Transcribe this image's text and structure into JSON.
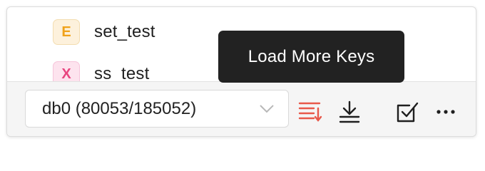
{
  "keys": [
    {
      "type_letter": "E",
      "name": "set_test",
      "color": "#f0a21b"
    },
    {
      "type_letter": "X",
      "name": "ss_test",
      "color": "#e8457f"
    }
  ],
  "toolbar": {
    "db_select_value": "db0 (80053/185052)",
    "icons": [
      "sort-keys-icon",
      "load-keys-icon",
      "batch-select-icon",
      "more-icon"
    ],
    "sort_icon_color": "#e8584a"
  },
  "tooltip": {
    "text": "Load More Keys"
  }
}
